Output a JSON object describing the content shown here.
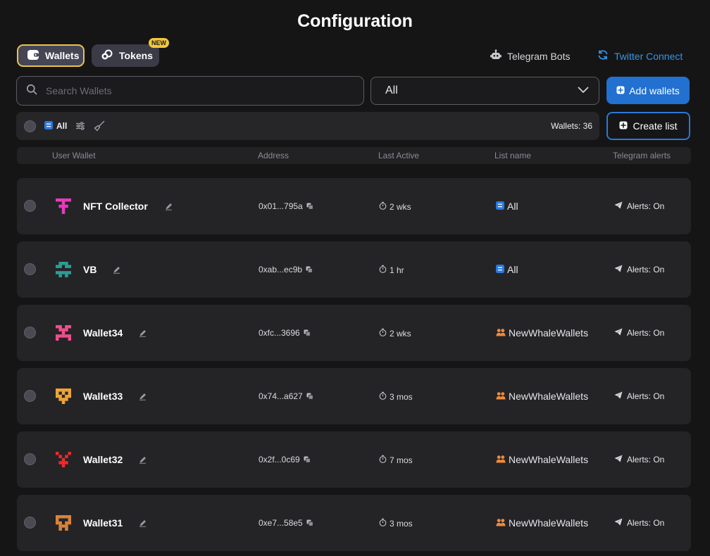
{
  "page": {
    "title": "Configuration"
  },
  "tabs": {
    "wallets_label": "Wallets",
    "tokens_label": "Tokens",
    "tokens_badge": "NEW"
  },
  "links": {
    "telegram_bots": "Telegram Bots",
    "twitter_connect": "Twitter Connect"
  },
  "search": {
    "placeholder": "Search Wallets",
    "value": ""
  },
  "filter_select": {
    "value": "All"
  },
  "buttons": {
    "add_wallets": "Add wallets",
    "create_list": "Create list"
  },
  "filter_bar": {
    "chip_label": "All",
    "wallet_count": "Wallets: 36"
  },
  "table": {
    "headers": [
      "User Wallet",
      "Address",
      "Last Active",
      "List name",
      "Telegram alerts"
    ],
    "rows": [
      {
        "name": "NFT Collector",
        "address": "0x01...795a",
        "last_active": "2 wks",
        "list_name": "All",
        "list_icon": "list-icon",
        "alerts": "Alerts: On",
        "avatar_color": "#e93bbd"
      },
      {
        "name": "VB",
        "address": "0xab...ec9b",
        "last_active": "1 hr",
        "list_name": "All",
        "list_icon": "list-icon",
        "alerts": "Alerts: On",
        "avatar_color": "#2e9e92"
      },
      {
        "name": "Wallet34",
        "address": "0xfc...3696",
        "last_active": "2 wks",
        "list_name": "NewWhaleWallets",
        "list_icon": "people-icon",
        "alerts": "Alerts: On",
        "avatar_color": "#ef4e8e"
      },
      {
        "name": "Wallet33",
        "address": "0x74...a627",
        "last_active": "3 mos",
        "list_name": "NewWhaleWallets",
        "list_icon": "people-icon",
        "alerts": "Alerts: On",
        "avatar_color": "#f0a53a"
      },
      {
        "name": "Wallet32",
        "address": "0x2f...0c69",
        "last_active": "7 mos",
        "list_name": "NewWhaleWallets",
        "list_icon": "people-icon",
        "alerts": "Alerts: On",
        "avatar_color": "#ee2b2b"
      },
      {
        "name": "Wallet31",
        "address": "0xe7...58e5",
        "last_active": "3 mos",
        "list_name": "NewWhaleWallets",
        "list_icon": "people-icon",
        "alerts": "Alerts: On",
        "avatar_color": "#d9843a"
      }
    ]
  },
  "colors": {
    "background": "#151516",
    "accent_blue": "#2270d0",
    "twitter_blue": "#3a94e6",
    "highlight_yellow": "#e9c44a",
    "people_icon_orange": "#f08a3a"
  }
}
